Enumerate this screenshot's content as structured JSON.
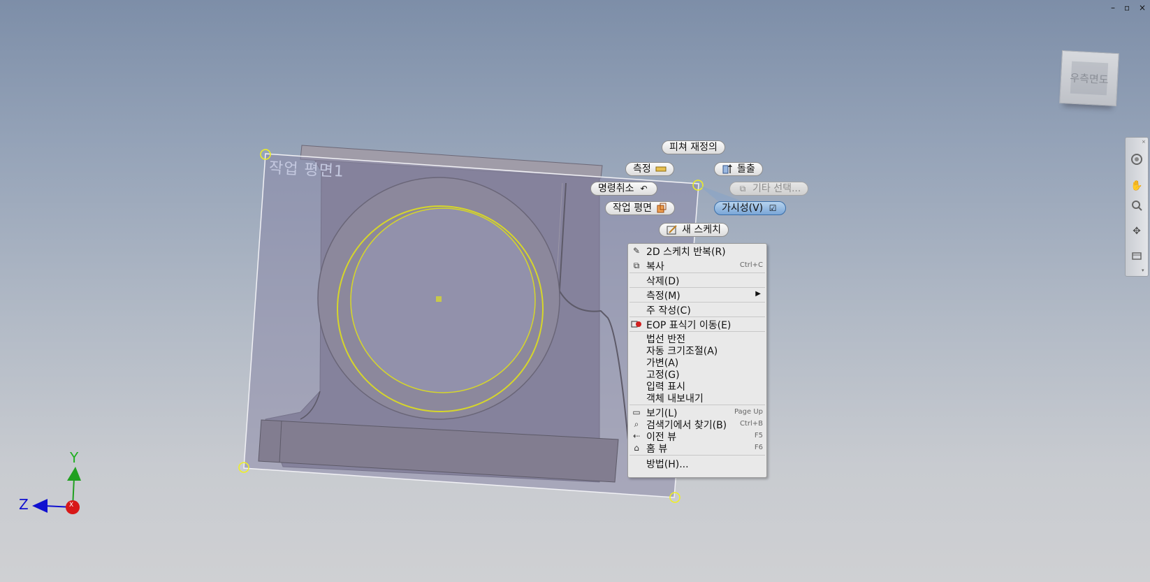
{
  "window_controls": {
    "minimize": "–",
    "restore": "▫",
    "close": "×"
  },
  "viewcube": {
    "label": "우측면도"
  },
  "navbar": {
    "close": "×",
    "wheel_icon": "steering-wheel-icon",
    "pan_icon": "hand-icon",
    "zoom_icon": "zoom-icon",
    "orbit_icon": "orbit-icon",
    "look_icon": "look-icon",
    "more": "▾"
  },
  "plane": {
    "label": "작업 평면1"
  },
  "axes": {
    "y": "Y",
    "z": "Z",
    "x_marker": "X"
  },
  "mini_toolbar": {
    "redefine": "피쳐 재정의",
    "measure": "측정",
    "extrude": "돌출",
    "cancel": "명령취소",
    "other_select": "기타 선택...",
    "work_plane": "작업 평면",
    "visibility": "가시성(V)",
    "visibility_checked": "☑",
    "new_sketch": "새 스케치"
  },
  "context_menu": {
    "items": [
      {
        "label": "2D 스케치 반복(R)",
        "key": "",
        "icon": "sketch-icon"
      },
      {
        "label": "복사",
        "key": "Ctrl+C",
        "icon": "copy-icon"
      },
      {
        "label": "삭제(D)",
        "key": "",
        "icon": ""
      },
      {
        "label": "측정(M)",
        "key": "",
        "icon": "",
        "submenu": "▶"
      },
      {
        "label": "주 작성(C)",
        "key": "",
        "icon": ""
      },
      {
        "label": "EOP 표식기 이동(E)",
        "key": "",
        "icon": "eop-marker-icon"
      },
      {
        "label": "법선 반전",
        "key": "",
        "icon": ""
      },
      {
        "label": "자동 크기조절(A)",
        "key": "",
        "icon": ""
      },
      {
        "label": "가변(A)",
        "key": "",
        "icon": ""
      },
      {
        "label": "고정(G)",
        "key": "",
        "icon": ""
      },
      {
        "label": "입력 표시",
        "key": "",
        "icon": ""
      },
      {
        "label": "객체 내보내기",
        "key": "",
        "icon": ""
      },
      {
        "label": "보기(L)",
        "key": "Page Up",
        "icon": "view-icon"
      },
      {
        "label": "검색기에서 찾기(B)",
        "key": "Ctrl+B",
        "icon": "find-icon"
      },
      {
        "label": "이전 뷰",
        "key": "F5",
        "icon": "previous-view-icon"
      },
      {
        "label": "홈 뷰",
        "key": "F6",
        "icon": "home-icon"
      },
      {
        "label": "방법(H)...",
        "key": "",
        "icon": ""
      }
    ]
  },
  "colors": {
    "plane_fill": "#8a88a8",
    "highlight": "#e0e020",
    "menu_bg": "#e9e9e9"
  }
}
